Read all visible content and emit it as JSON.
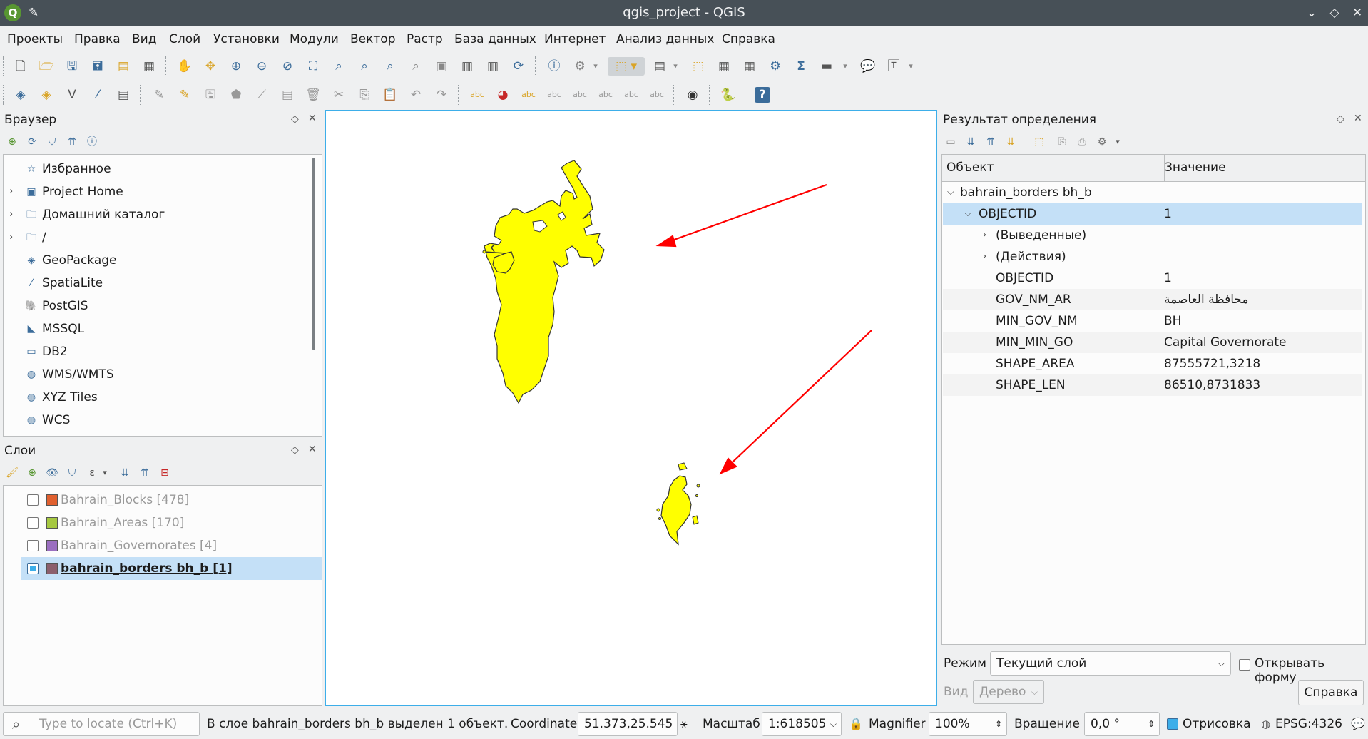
{
  "window": {
    "title": "qgis_project - QGIS",
    "logo_letter": "Q",
    "controls": [
      "⌄",
      "◇",
      "✕"
    ]
  },
  "menu": [
    "Проекты",
    "Правка",
    "Вид",
    "Слой",
    "Установки",
    "Модули",
    "Вектор",
    "Растр",
    "База данных",
    "Интернет",
    "Анализ данных",
    "Справка"
  ],
  "browser": {
    "title": "Браузер",
    "items": [
      {
        "label": "Избранное",
        "icon": "star-icon",
        "glyph": "☆",
        "expandable": false
      },
      {
        "label": "Project Home",
        "icon": "project-home-icon",
        "glyph": "▣",
        "expandable": true
      },
      {
        "label": "Домашний каталог",
        "icon": "folder-icon",
        "glyph": "🗀",
        "expandable": true
      },
      {
        "label": "/",
        "icon": "folder-icon",
        "glyph": "🗀",
        "expandable": true
      },
      {
        "label": "GeoPackage",
        "icon": "geopackage-icon",
        "glyph": "◈",
        "expandable": false
      },
      {
        "label": "SpatiaLite",
        "icon": "spatialite-icon",
        "glyph": "⁄",
        "expandable": false
      },
      {
        "label": "PostGIS",
        "icon": "postgis-icon",
        "glyph": "🐘",
        "expandable": false
      },
      {
        "label": "MSSQL",
        "icon": "mssql-icon",
        "glyph": "◣",
        "expandable": false
      },
      {
        "label": "DB2",
        "icon": "db2-icon",
        "glyph": "▭",
        "expandable": false
      },
      {
        "label": "WMS/WMTS",
        "icon": "globe-icon",
        "glyph": "◍",
        "expandable": false
      },
      {
        "label": "XYZ Tiles",
        "icon": "globe-icon",
        "glyph": "◍",
        "expandable": false
      },
      {
        "label": "WCS",
        "icon": "globe-icon",
        "glyph": "◍",
        "expandable": false
      }
    ]
  },
  "layers": {
    "title": "Слои",
    "items": [
      {
        "label": "Bahrain_Blocks [478]",
        "color": "#e0602f",
        "checked": false,
        "active": false
      },
      {
        "label": "Bahrain_Areas [170]",
        "color": "#a6c841",
        "checked": false,
        "active": false
      },
      {
        "label": "Bahrain_Governorates [4]",
        "color": "#9b6fc0",
        "checked": false,
        "active": false
      },
      {
        "label": "bahrain_borders bh_b [1]",
        "color": "#8c5f6d",
        "checked": true,
        "active": true
      }
    ]
  },
  "identify": {
    "title": "Результат определения",
    "col_feature": "Объект",
    "col_value": "Значение",
    "layer_name": "bahrain_borders bh_b",
    "feature_key": "OBJECTID",
    "feature_val": "1",
    "derived": "(Выведенные)",
    "actions": "(Действия)",
    "attributes": [
      {
        "key": "OBJECTID",
        "value": "1"
      },
      {
        "key": "GOV_NM_AR",
        "value": "محافظة العاصمة"
      },
      {
        "key": "MIN_GOV_NM",
        "value": "BH"
      },
      {
        "key": "MIN_MIN_GO",
        "value": "Capital Governorate"
      },
      {
        "key": "SHAPE_AREA",
        "value": "87555721,3218"
      },
      {
        "key": "SHAPE_LEN",
        "value": "86510,8731833"
      }
    ],
    "mode_label": "Режим",
    "mode_value": "Текущий слой",
    "open_form_label": "Открывать форму",
    "view_label": "Вид",
    "view_value": "Дерево",
    "help_label": "Справка"
  },
  "status": {
    "locate_placeholder": "Type to locate (Ctrl+K)",
    "message": "В слое bahrain_borders bh_b выделен 1 объект.",
    "coordinate_label": "Coordinate",
    "coordinate_value": "51.373,25.545",
    "scale_label": "Масштаб",
    "scale_value": "1:618505",
    "magnifier_label": "Magnifier",
    "magnifier_value": "100%",
    "rotation_label": "Вращение",
    "rotation_value": "0,0 °",
    "render_label": "Отрисовка",
    "crs": "EPSG:4326"
  },
  "colors": {
    "feature_fill": "#ffff00",
    "arrow": "#ff0000",
    "selection": "#c4e0f7",
    "titlebar": "#475057"
  }
}
